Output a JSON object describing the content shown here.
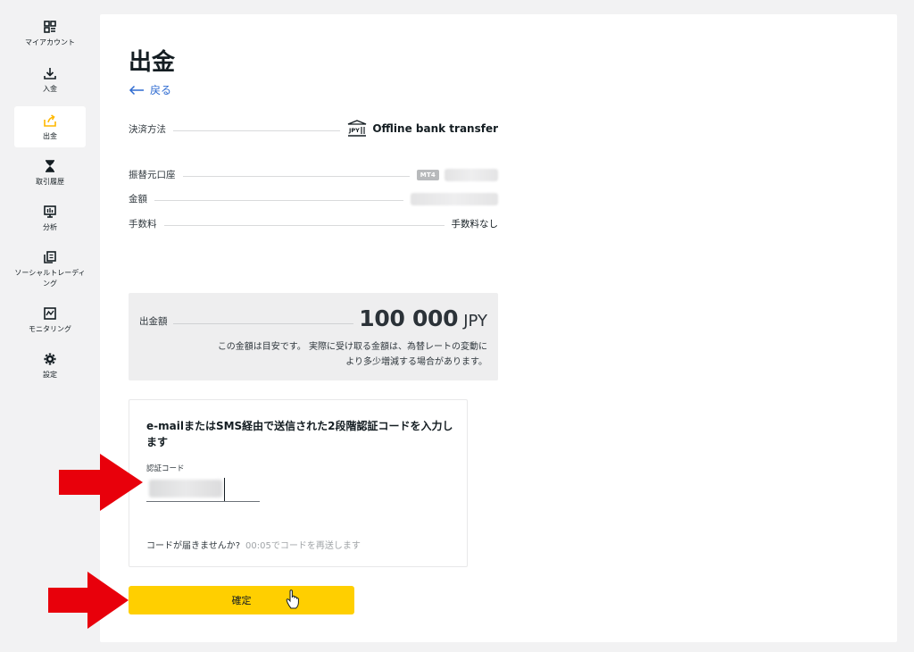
{
  "sidebar": {
    "items": [
      {
        "label": "マイアカウント",
        "icon": "grid-icon"
      },
      {
        "label": "入金",
        "icon": "download-icon"
      },
      {
        "label": "出金",
        "icon": "upload-icon"
      },
      {
        "label": "取引履歴",
        "icon": "hourglass-icon"
      },
      {
        "label": "分析",
        "icon": "analytics-icon"
      },
      {
        "label": "ソーシャルトレーディング",
        "icon": "copy-icon"
      },
      {
        "label": "モニタリング",
        "icon": "monitor-icon"
      },
      {
        "label": "設定",
        "icon": "gear-icon"
      }
    ],
    "active_index": 2,
    "active_color": "#ffb800"
  },
  "page": {
    "title": "出金",
    "back_label": "戻る"
  },
  "details": {
    "method_label": "決済方法",
    "method_value": "Offline bank transfer",
    "account_label": "振替元口座",
    "account_badge": "MT4",
    "amount_label": "金額",
    "fee_label": "手数料",
    "fee_value": "手数料なし"
  },
  "summary": {
    "label": "出金額",
    "amount": "100 000",
    "currency": "JPY",
    "note_line1": "この金額は目安です。 実際に受け取る金額は、為替レートの変動に",
    "note_line2": "より多少増減する場合があります。"
  },
  "verification": {
    "instruction": "e-mailまたはSMS経由で送信された2段階認証コードを入力します",
    "code_label": "認証コード",
    "resend_text": "コードが届きませんか?",
    "resend_timer": "00:05でコードを再送します"
  },
  "confirm_label": "確定",
  "colors": {
    "accent": "#ffcf00",
    "link": "#2e6bd1",
    "arrow": "#e8000b"
  }
}
